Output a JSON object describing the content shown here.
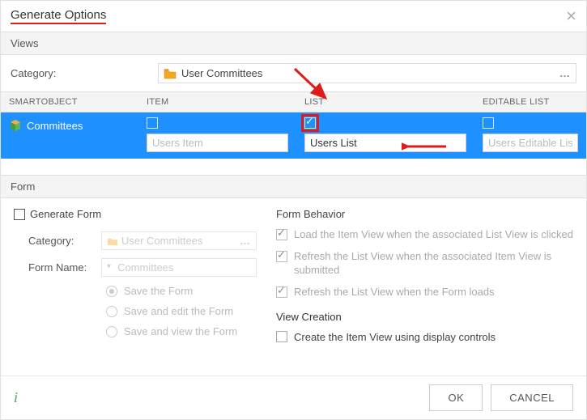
{
  "header": {
    "title": "Generate Options"
  },
  "views": {
    "sectionLabel": "Views",
    "categoryLabel": "Category:",
    "categoryValue": "User Committees",
    "columns": {
      "so": "SMARTOBJECT",
      "item": "ITEM",
      "list": "LIST",
      "el": "EDITABLE LIST"
    },
    "row": {
      "soName": "Committees",
      "item": {
        "checked": false,
        "input": "Users Item"
      },
      "list": {
        "checked": true,
        "input": "Users List"
      },
      "el": {
        "checked": false,
        "input": "Users Editable List"
      }
    }
  },
  "form": {
    "sectionLabel": "Form",
    "generateLabel": "Generate Form",
    "categoryLabel": "Category:",
    "categoryValue": "User Committees",
    "formNameLabel": "Form Name:",
    "formNameValue": "Committees",
    "radios": {
      "save": "Save the Form",
      "edit": "Save and edit the Form",
      "view": "Save and view the Form"
    },
    "behavior": {
      "title": "Form Behavior",
      "opt1": "Load the Item View when the associated List View is clicked",
      "opt2": "Refresh the List View when the associated Item View is submitted",
      "opt3": "Refresh the List View when the Form loads"
    },
    "viewCreation": {
      "title": "View Creation",
      "opt1": "Create the Item View using display controls"
    }
  },
  "footer": {
    "ok": "OK",
    "cancel": "CANCEL"
  }
}
